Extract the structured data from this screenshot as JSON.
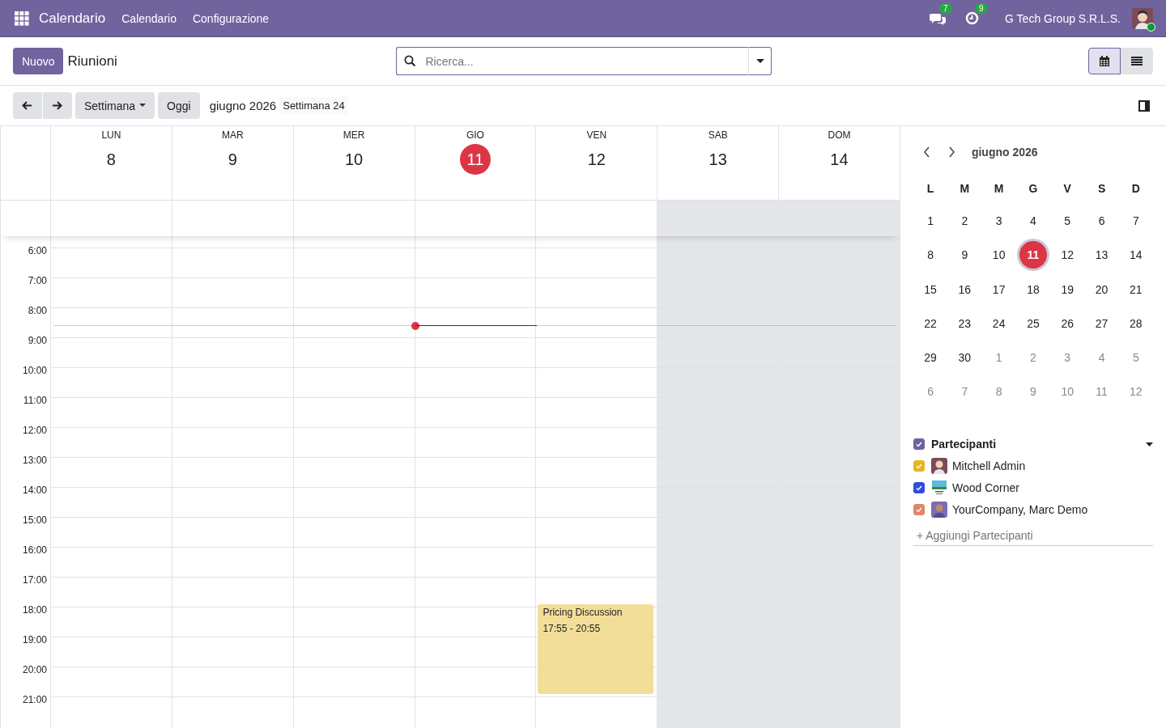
{
  "navbar": {
    "app_name": "Calendario",
    "menus": [
      "Calendario",
      "Configurazione"
    ],
    "messages_badge": "7",
    "activities_badge": "9",
    "company": "G Tech Group S.R.L.S.",
    "user_online": true
  },
  "control_panel": {
    "new_button": "Nuovo",
    "breadcrumb": "Riunioni",
    "search": {
      "placeholder": "Ricerca..."
    },
    "views": [
      {
        "kind": "calendar",
        "selected": true
      },
      {
        "kind": "list",
        "selected": false
      }
    ]
  },
  "toolbar": {
    "scale": "Settimana",
    "today": "Oggi",
    "period": "giugno 2026",
    "week": "Settimana 24"
  },
  "week": {
    "days": [
      {
        "name": "LUN",
        "date": "8",
        "today": false,
        "weekend": false
      },
      {
        "name": "MAR",
        "date": "9",
        "today": false,
        "weekend": false
      },
      {
        "name": "MER",
        "date": "10",
        "today": false,
        "weekend": false
      },
      {
        "name": "GIO",
        "date": "11",
        "today": true,
        "weekend": false
      },
      {
        "name": "VEN",
        "date": "12",
        "today": false,
        "weekend": false,
        "events": [
          {
            "title": "Pricing Discussion",
            "time": "17:55 - 20:55",
            "color": "#f3de99"
          }
        ]
      },
      {
        "name": "SAB",
        "date": "13",
        "today": false,
        "weekend": true
      },
      {
        "name": "DOM",
        "date": "14",
        "today": false,
        "weekend": true
      }
    ],
    "hours": [
      "6:00",
      "7:00",
      "8:00",
      "9:00",
      "10:00",
      "11:00",
      "12:00",
      "13:00",
      "14:00",
      "15:00",
      "16:00",
      "17:00",
      "18:00",
      "19:00",
      "20:00",
      "21:00"
    ]
  },
  "sidebar": {
    "month": "giugno 2026",
    "weekdays": [
      "L",
      "M",
      "M",
      "G",
      "V",
      "S",
      "D"
    ],
    "weeks": [
      [
        {
          "d": "1",
          "other_month": false,
          "selected": false
        },
        {
          "d": "2",
          "other_month": false,
          "selected": false
        },
        {
          "d": "3",
          "other_month": false,
          "selected": false
        },
        {
          "d": "4",
          "other_month": false,
          "selected": false
        },
        {
          "d": "5",
          "other_month": false,
          "selected": false
        },
        {
          "d": "6",
          "other_month": false,
          "selected": false
        },
        {
          "d": "7",
          "other_month": false,
          "selected": false
        }
      ],
      [
        {
          "d": "8",
          "other_month": false,
          "selected": false
        },
        {
          "d": "9",
          "other_month": false,
          "selected": false
        },
        {
          "d": "10",
          "other_month": false,
          "selected": false
        },
        {
          "d": "11",
          "other_month": false,
          "selected": true
        },
        {
          "d": "12",
          "other_month": false,
          "selected": false
        },
        {
          "d": "13",
          "other_month": false,
          "selected": false
        },
        {
          "d": "14",
          "other_month": false,
          "selected": false
        }
      ],
      [
        {
          "d": "15",
          "other_month": false,
          "selected": false
        },
        {
          "d": "16",
          "other_month": false,
          "selected": false
        },
        {
          "d": "17",
          "other_month": false,
          "selected": false
        },
        {
          "d": "18",
          "other_month": false,
          "selected": false
        },
        {
          "d": "19",
          "other_month": false,
          "selected": false
        },
        {
          "d": "20",
          "other_month": false,
          "selected": false
        },
        {
          "d": "21",
          "other_month": false,
          "selected": false
        }
      ],
      [
        {
          "d": "22",
          "other_month": false,
          "selected": false
        },
        {
          "d": "23",
          "other_month": false,
          "selected": false
        },
        {
          "d": "24",
          "other_month": false,
          "selected": false
        },
        {
          "d": "25",
          "other_month": false,
          "selected": false
        },
        {
          "d": "26",
          "other_month": false,
          "selected": false
        },
        {
          "d": "27",
          "other_month": false,
          "selected": false
        },
        {
          "d": "28",
          "other_month": false,
          "selected": false
        }
      ],
      [
        {
          "d": "29",
          "other_month": false,
          "selected": false
        },
        {
          "d": "30",
          "other_month": false,
          "selected": false
        },
        {
          "d": "1",
          "other_month": true,
          "selected": false
        },
        {
          "d": "2",
          "other_month": true,
          "selected": false
        },
        {
          "d": "3",
          "other_month": true,
          "selected": false
        },
        {
          "d": "4",
          "other_month": true,
          "selected": false
        },
        {
          "d": "5",
          "other_month": true,
          "selected": false
        }
      ],
      [
        {
          "d": "6",
          "other_month": true,
          "selected": false
        },
        {
          "d": "7",
          "other_month": true,
          "selected": false
        },
        {
          "d": "8",
          "other_month": true,
          "selected": false
        },
        {
          "d": "9",
          "other_month": true,
          "selected": false
        },
        {
          "d": "10",
          "other_month": true,
          "selected": false
        },
        {
          "d": "11",
          "other_month": true,
          "selected": false
        },
        {
          "d": "12",
          "other_month": true,
          "selected": false
        }
      ]
    ],
    "filter": {
      "title": "Partecipanti",
      "color": "#71639e",
      "checked": true,
      "expanded": true,
      "items": [
        {
          "name": "Mitchell Admin",
          "color": "#e9b422",
          "checked": true,
          "kind": "person"
        },
        {
          "name": "Wood Corner",
          "color": "#2f4ede",
          "checked": true,
          "kind": "company"
        },
        {
          "name": "YourCompany, Marc Demo",
          "color": "#e0866a",
          "checked": true,
          "kind": "person"
        }
      ],
      "add_placeholder": "+ Aggiungi Partecipanti"
    }
  }
}
